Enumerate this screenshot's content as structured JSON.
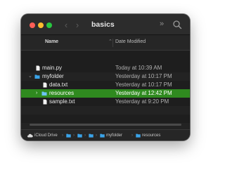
{
  "window": {
    "title": "basics"
  },
  "toolbar": {
    "back_icon": "chevron-left-icon",
    "forward_icon": "chevron-right-icon",
    "more_icon": "double-chevron-right-icon",
    "search_icon": "search-icon"
  },
  "columns": {
    "name": "Name",
    "date_modified": "Date Modified"
  },
  "files": [
    {
      "name": "main.py",
      "date": "Today at 10:39 AM",
      "kind": "file",
      "expanded": false,
      "selected": false
    },
    {
      "name": "myfolder",
      "date": "Yesterday at 10:17 PM",
      "kind": "folder",
      "expanded": true,
      "selected": false
    },
    {
      "name": "data.txt",
      "date": "Yesterday at 10:17 PM",
      "kind": "file",
      "expanded": false,
      "selected": false
    },
    {
      "name": "resources",
      "date": "Yesterday at 12:42 PM",
      "kind": "folder",
      "expanded": false,
      "selected": true
    },
    {
      "name": "sample.txt",
      "date": "Yesterday at 9:20 PM",
      "kind": "file",
      "expanded": false,
      "selected": false
    }
  ],
  "pathbar": {
    "items": [
      "iCloud Drive",
      "",
      "",
      "",
      "myfolder",
      "resources"
    ]
  },
  "colors": {
    "selection": "#2f8a1f",
    "folder": "#3aa3e8",
    "traffic_red": "#ff5f57",
    "traffic_yellow": "#febc2e",
    "traffic_green": "#28c840"
  }
}
